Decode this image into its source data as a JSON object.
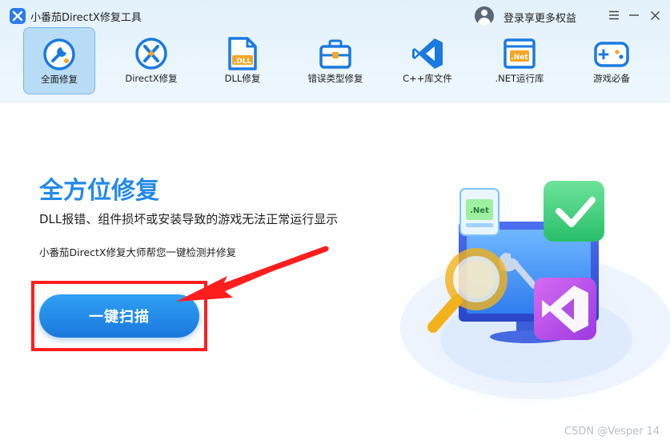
{
  "app": {
    "title": "小番茄DirectX修复工具",
    "login_text": "登录享更多权益",
    "accent_color": "#2489e8"
  },
  "window_controls": {
    "menu_icon": "hamburger-menu-icon",
    "minimize_icon": "minimize-icon",
    "close_icon": "close-icon"
  },
  "tabs": [
    {
      "label": "全面修复",
      "icon": "wrench-icon",
      "active": true
    },
    {
      "label": "DirectX修复",
      "icon": "directx-icon",
      "active": false
    },
    {
      "label": "DLL修复",
      "icon": "dll-file-icon",
      "active": false
    },
    {
      "label": "错误类型修复",
      "icon": "toolbox-icon",
      "active": false
    },
    {
      "label": "C++库文件",
      "icon": "visual-studio-icon",
      "active": false
    },
    {
      "label": ".NET运行库",
      "icon": "dotnet-window-icon",
      "active": false
    },
    {
      "label": "游戏必备",
      "icon": "gamepad-icon",
      "active": false
    }
  ],
  "hero": {
    "title": "全方位修复",
    "description": "DLL报错、组件损坏或安装导致的游戏无法正常运行显示",
    "subtext": "小番茄DirectX修复大师帮您一键检测并修复",
    "scan_button": "一键扫描"
  },
  "illustration": {
    "net_label": ".Net"
  },
  "watermark": "CSDN @Vesper 14"
}
